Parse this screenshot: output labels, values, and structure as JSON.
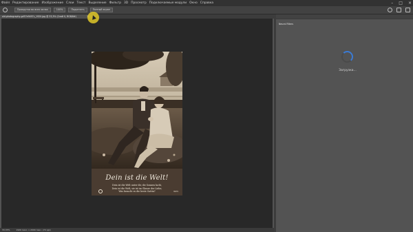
{
  "menu": [
    "Файл",
    "Редактирование",
    "Изображение",
    "Слои",
    "Текст",
    "Выделение",
    "Фильтр",
    "3D",
    "Просмотр",
    "Подключаемые модули",
    "Окно",
    "Справка"
  ],
  "options": {
    "scroll_all": "Прокрутка во всех окнах",
    "zoom": "100%",
    "fit": "Подогнать",
    "fill_screen": "Полный экран"
  },
  "document": {
    "tab_title": "old-photography-gd57e9497c_1920.jpg @ 33,3% (Слой 0, RGB/8#)",
    "close": "×"
  },
  "image": {
    "title": "Dein ist die Welt!",
    "caption": [
      "Dein ist die Welt unter dir, die Sonnen lacht,",
      "Dein ist die Welt, sie ist im Glanze der Liebe,",
      "Was braucht es die beste Gattin?"
    ],
    "serial": "3975"
  },
  "status": {
    "zoom": "33,33%",
    "doc_info": "1920 пикс. х 2000 пикс. (72 ppi)"
  },
  "panel": {
    "tab": "Neural Filters",
    "loading": "Загрузка..."
  },
  "colors": {
    "accent": "#3a7bd5",
    "canvas": "#282828",
    "workspace": "#535353"
  }
}
